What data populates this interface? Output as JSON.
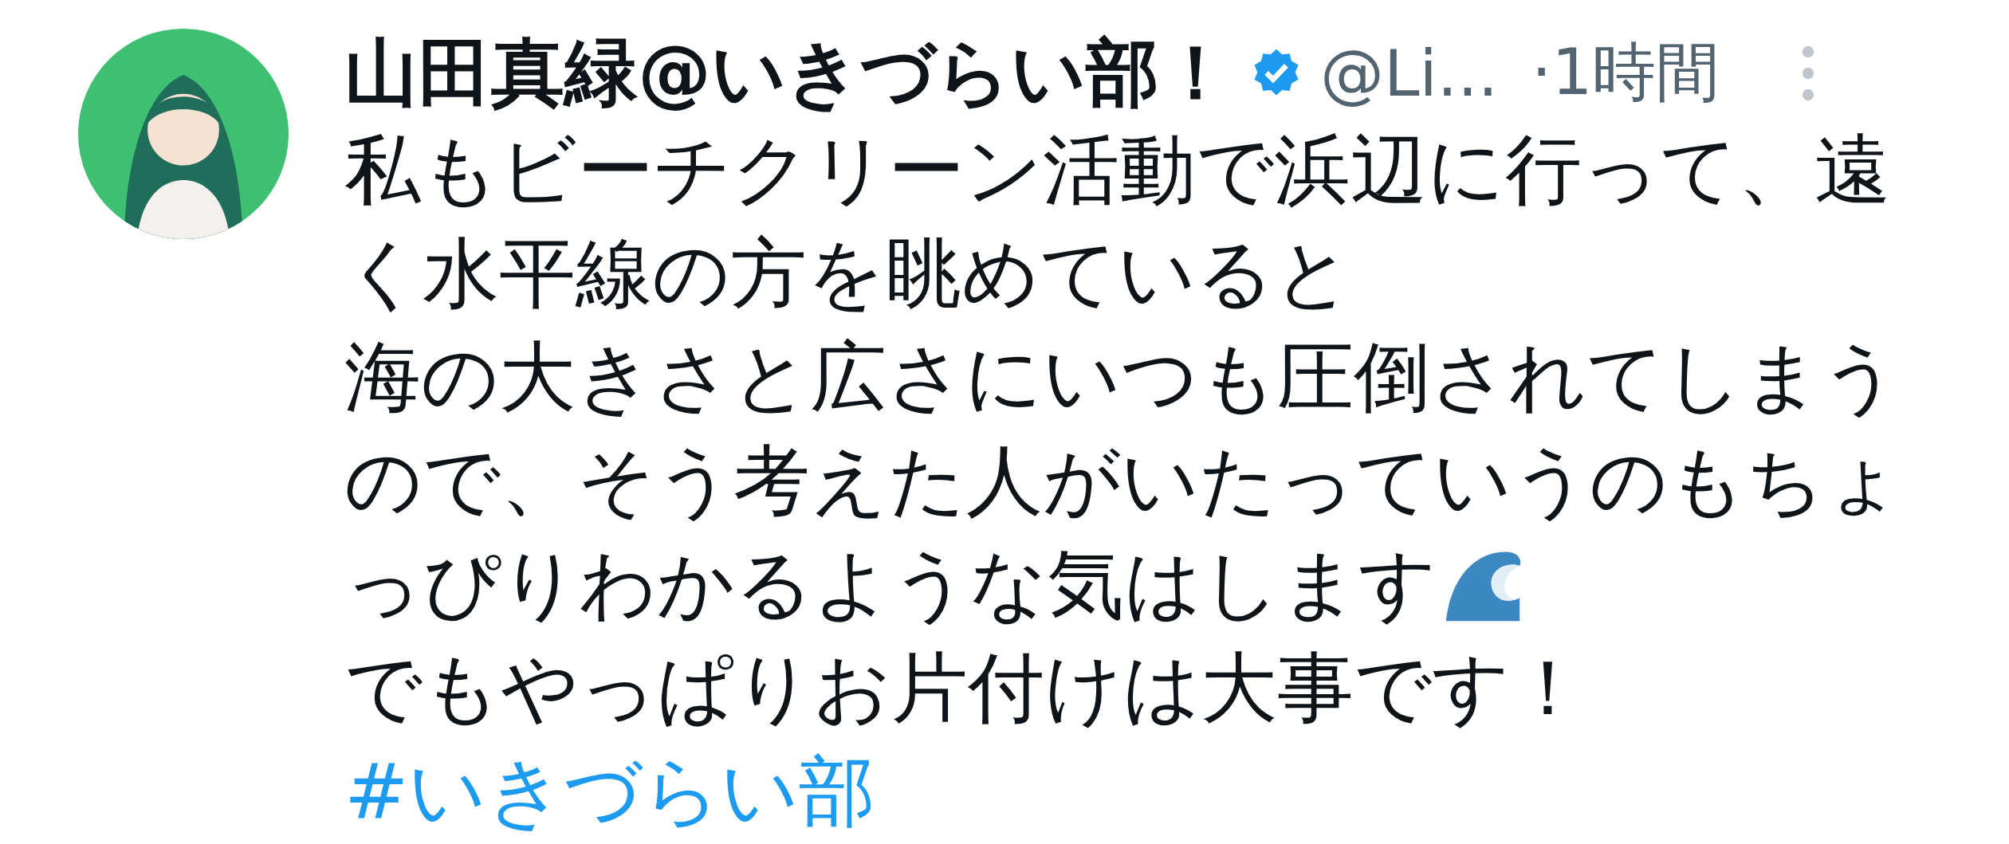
{
  "post": {
    "author": {
      "name": "山田真緑@いきづらい部！",
      "verified": true,
      "handle": "@Li...",
      "time": "·1時間"
    },
    "lines": [
      {
        "kind": "text",
        "text": "私もビーチクリーン活動で浜辺に行って、遠"
      },
      {
        "kind": "text",
        "text": "く水平線の方を眺めていると"
      },
      {
        "kind": "text",
        "text": "海の大きさと広さにいつも圧倒されてしまう"
      },
      {
        "kind": "text",
        "text": "ので、そう考えた人がいたっていうのもちょ"
      },
      {
        "kind": "text",
        "text": "っぴりわかるような気はします",
        "wave_icon": true
      },
      {
        "kind": "text",
        "text": "でもやっぱりお片付けは大事です！"
      },
      {
        "kind": "hashtag",
        "text": "#いきづらい部"
      }
    ]
  }
}
